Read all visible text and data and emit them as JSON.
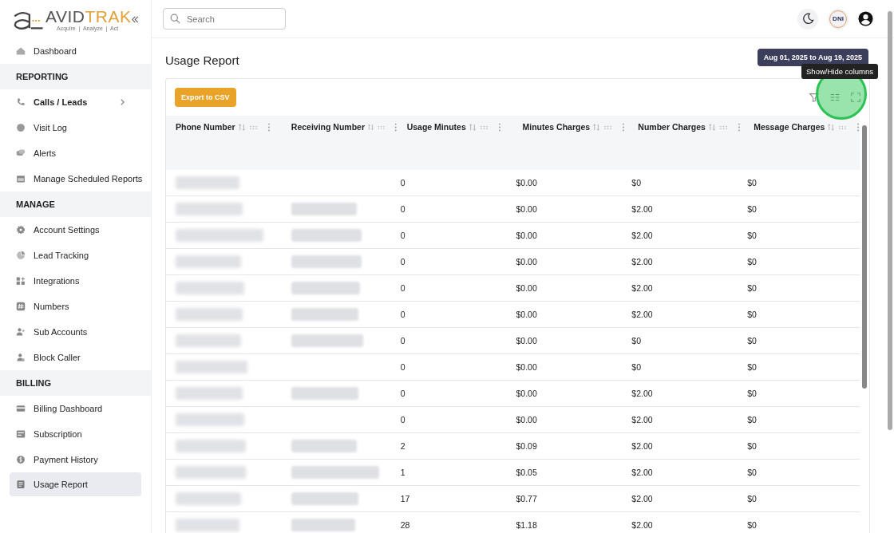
{
  "brand": {
    "first": "AVID",
    "second": "TRAK",
    "tagline": "Acquire  |  Analyze  |  Act"
  },
  "sidebar": {
    "top": [
      {
        "label": "Dashboard",
        "selected": false
      }
    ],
    "sections": [
      {
        "title": "REPORTING",
        "items": [
          {
            "label": "Calls / Leads",
            "selected": false,
            "expandable": true
          },
          {
            "label": "Visit Log",
            "selected": false,
            "expandable": false
          },
          {
            "label": "Alerts",
            "selected": false,
            "expandable": false
          },
          {
            "label": "Manage Scheduled Reports",
            "selected": false,
            "expandable": false
          }
        ]
      },
      {
        "title": "MANAGE",
        "items": [
          {
            "label": "Account Settings",
            "selected": false,
            "expandable": false
          },
          {
            "label": "Lead Tracking",
            "selected": false,
            "expandable": false
          },
          {
            "label": "Integrations",
            "selected": false,
            "expandable": false
          },
          {
            "label": "Numbers",
            "selected": false,
            "expandable": false
          },
          {
            "label": "Sub Accounts",
            "selected": false,
            "expandable": false
          },
          {
            "label": "Block Caller",
            "selected": false,
            "expandable": false
          }
        ]
      },
      {
        "title": "BILLING",
        "items": [
          {
            "label": "Billing Dashboard",
            "selected": false,
            "expandable": false
          },
          {
            "label": "Subscription",
            "selected": false,
            "expandable": false
          },
          {
            "label": "Payment History",
            "selected": false,
            "expandable": false
          },
          {
            "label": "Usage Report",
            "selected": true,
            "expandable": false
          }
        ]
      }
    ]
  },
  "search": {
    "placeholder": "Search"
  },
  "header": {
    "badge": "DNI"
  },
  "page": {
    "title": "Usage Report",
    "date_range": "Aug 01, 2025 to Aug 19, 2025",
    "tooltip": "Show/Hide columns",
    "export_button": "Export to CSV"
  },
  "table": {
    "columns": [
      "Phone Number",
      "Receiving Number",
      "Usage Minutes",
      "Minutes Charges",
      "Number Charges",
      "Message Charges"
    ],
    "rows": [
      {
        "receiving_shown": false,
        "cells": [
          "",
          "",
          "0",
          "$0.00",
          "$0",
          "$0"
        ]
      },
      {
        "receiving_shown": true,
        "cells": [
          "",
          "",
          "0",
          "$0.00",
          "$2.00",
          "$0"
        ]
      },
      {
        "receiving_shown": true,
        "cells": [
          "",
          "",
          "0",
          "$0.00",
          "$2.00",
          "$0"
        ]
      },
      {
        "receiving_shown": true,
        "cells": [
          "",
          "",
          "0",
          "$0.00",
          "$2.00",
          "$0"
        ]
      },
      {
        "receiving_shown": true,
        "cells": [
          "",
          "",
          "0",
          "$0.00",
          "$2.00",
          "$0"
        ]
      },
      {
        "receiving_shown": true,
        "cells": [
          "",
          "",
          "0",
          "$0.00",
          "$2.00",
          "$0"
        ]
      },
      {
        "receiving_shown": true,
        "cells": [
          "",
          "",
          "0",
          "$0.00",
          "$0",
          "$0"
        ]
      },
      {
        "receiving_shown": false,
        "cells": [
          "",
          "",
          "0",
          "$0.00",
          "$0",
          "$0"
        ]
      },
      {
        "receiving_shown": true,
        "cells": [
          "",
          "",
          "0",
          "$0.00",
          "$2.00",
          "$0"
        ]
      },
      {
        "receiving_shown": false,
        "cells": [
          "",
          "",
          "0",
          "$0.00",
          "$2.00",
          "$0"
        ]
      },
      {
        "receiving_shown": true,
        "cells": [
          "",
          "",
          "2",
          "$0.09",
          "$2.00",
          "$0"
        ]
      },
      {
        "receiving_shown": true,
        "cells": [
          "",
          "",
          "1",
          "$0.05",
          "$2.00",
          "$0"
        ]
      },
      {
        "receiving_shown": true,
        "cells": [
          "",
          "",
          "17",
          "$0.77",
          "$2.00",
          "$0"
        ]
      },
      {
        "receiving_shown": true,
        "cells": [
          "",
          "",
          "28",
          "$1.18",
          "$2.00",
          "$0"
        ]
      }
    ]
  }
}
